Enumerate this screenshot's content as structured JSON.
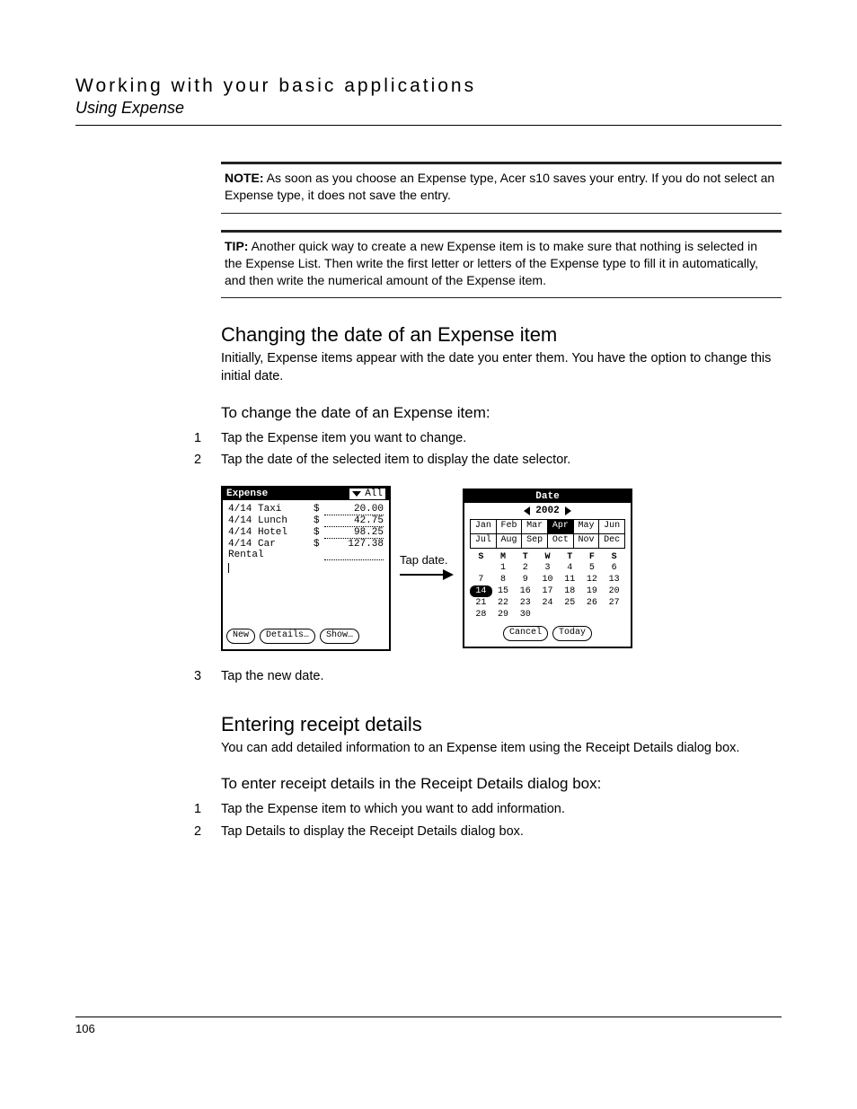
{
  "header": {
    "title": "Working with your basic applications",
    "subtitle": "Using Expense"
  },
  "note": {
    "label": "NOTE:",
    "text": " As soon as you choose an Expense type, Acer s10 saves your entry. If you do not select an Expense type, it does not save the entry."
  },
  "tip": {
    "label": "TIP:",
    "text": " Another quick way to create a new Expense item is to make sure that nothing is selected in the Expense List. Then write the first letter or letters of the Expense type to fill it in automatically, and then write the numerical amount of the Expense item."
  },
  "sec1": {
    "heading": "Changing the date of an Expense item",
    "body": "Initially, Expense items appear with the date you enter them. You have the option to change this initial date.",
    "subheading": "To change the date of an Expense item:",
    "steps": [
      "Tap the Expense item you want to change.",
      "Tap the date of the selected item to display the date selector.",
      "Tap the new date."
    ]
  },
  "sec2": {
    "heading": "Entering receipt details",
    "body": "You can add detailed information to an Expense item using the Receipt Details dialog box.",
    "subheading": "To enter receipt details in the Receipt Details dialog box:",
    "steps": [
      "Tap the Expense item to which you want to add information.",
      "Tap Details to display the Receipt Details dialog box."
    ]
  },
  "callout": "Tap date.",
  "expense_screen": {
    "title": "Expense",
    "filter": "All",
    "rows": [
      {
        "date": "4/14",
        "desc": "Taxi",
        "cur": "$",
        "amt": "20.00"
      },
      {
        "date": "4/14",
        "desc": "Lunch",
        "cur": "$",
        "amt": "42.75"
      },
      {
        "date": "4/14",
        "desc": "Hotel",
        "cur": "$",
        "amt": "98.25"
      },
      {
        "date": "4/14",
        "desc": "Car Rental",
        "cur": "$",
        "amt": "127.38"
      }
    ],
    "buttons": [
      "New",
      "Details…",
      "Show…"
    ]
  },
  "date_screen": {
    "title": "Date",
    "year": "2002",
    "months": [
      "Jan",
      "Feb",
      "Mar",
      "Apr",
      "May",
      "Jun",
      "Jul",
      "Aug",
      "Sep",
      "Oct",
      "Nov",
      "Dec"
    ],
    "selected_month": "Apr",
    "dow": [
      "S",
      "M",
      "T",
      "W",
      "T",
      "F",
      "S"
    ],
    "weeks": [
      [
        "",
        "1",
        "2",
        "3",
        "4",
        "5",
        "6"
      ],
      [
        "7",
        "8",
        "9",
        "10",
        "11",
        "12",
        "13"
      ],
      [
        "14",
        "15",
        "16",
        "17",
        "18",
        "19",
        "20"
      ],
      [
        "21",
        "22",
        "23",
        "24",
        "25",
        "26",
        "27"
      ],
      [
        "28",
        "29",
        "30",
        "",
        "",
        "",
        ""
      ]
    ],
    "selected_day": "14",
    "buttons": [
      "Cancel",
      "Today"
    ]
  },
  "page_number": "106"
}
